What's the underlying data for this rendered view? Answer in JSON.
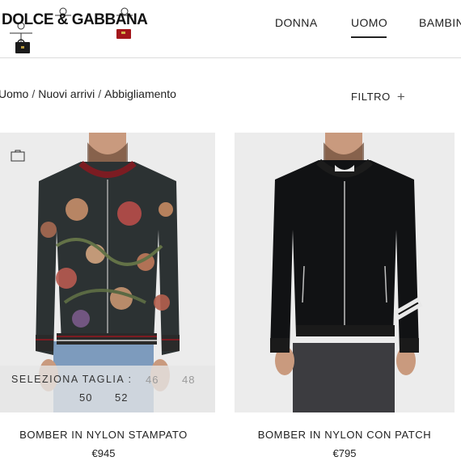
{
  "brand": {
    "logo_text": "DOLCE & GABBANA"
  },
  "nav": {
    "items": [
      "DONNA",
      "UOMO",
      "BAMBIN"
    ],
    "active": "UOMO"
  },
  "breadcrumb": [
    "Uomo",
    "Nuovi arrivi",
    "Abbigliamento"
  ],
  "filter": {
    "label": "FILTRO",
    "icon": "plus-icon"
  },
  "products": [
    {
      "name": "BOMBER IN NYLON STAMPATO",
      "price": "€945",
      "size_label": "SELEZIONA TAGLIA :",
      "sizes": [
        {
          "label": "46",
          "available": false
        },
        {
          "label": "48",
          "available": false
        },
        {
          "label": "50",
          "available": true
        },
        {
          "label": "52",
          "available": true
        }
      ],
      "icon": "shopping-bag-icon"
    },
    {
      "name": "BOMBER IN NYLON CON PATCH",
      "price": "€795"
    }
  ],
  "colors": {
    "divider": "#dcdcdc",
    "image_bg": "#ececec",
    "text": "#222222",
    "unavailable": "#9a9a9a"
  }
}
